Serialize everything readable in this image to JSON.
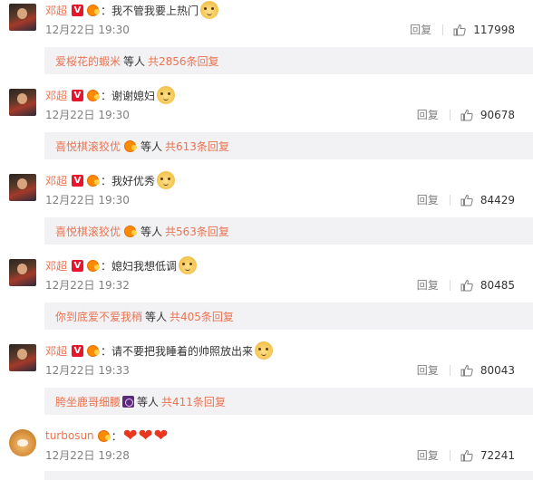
{
  "comments": [
    {
      "username": "邓超",
      "text": "：我不管我要上热门",
      "time": "12月22日 19:30",
      "reply_label": "回复",
      "likes": "117998",
      "reply_preview": {
        "who": "爱桜花的蝦米",
        "mid": "等人",
        "total": "共2856条回复"
      }
    },
    {
      "username": "邓超",
      "text": "：谢谢媳妇",
      "time": "12月22日 19:30",
      "reply_label": "回复",
      "likes": "90678",
      "reply_preview": {
        "who": "喜悦棋滚狡优",
        "mid": "等人",
        "total": "共613条回复"
      }
    },
    {
      "username": "邓超",
      "text": "：我好优秀",
      "time": "12月22日 19:30",
      "reply_label": "回复",
      "likes": "84429",
      "reply_preview": {
        "who": "喜悦棋滚狡优",
        "mid": "等人",
        "total": "共563条回复"
      }
    },
    {
      "username": "邓超",
      "text": "：媳妇我想低调",
      "time": "12月22日 19:32",
      "reply_label": "回复",
      "likes": "80485",
      "reply_preview": {
        "who": "你到底爱不爱我稍",
        "mid": "等人",
        "total": "共405条回复"
      }
    },
    {
      "username": "邓超",
      "text": "：请不要把我睡着的帅照放出来",
      "time": "12月22日 19:33",
      "reply_label": "回复",
      "likes": "80043",
      "reply_preview": {
        "who": "胯坐鹿哥细腰",
        "mid": "等人",
        "total": "共411条回复"
      }
    },
    {
      "username": "turbosun",
      "text": "：",
      "time": "12月22日 19:28",
      "reply_label": "回复",
      "likes": "72241"
    }
  ],
  "colors": {
    "accent": "#eb7350",
    "verified": "#e6162d",
    "heart": "#e8361f"
  },
  "icons": {
    "like": "thumbs-up-icon",
    "verified": "verified-v-icon",
    "fan": "fan-badge-icon",
    "emoji": "doge-emoji-icon",
    "heart": "heart-emoji-icon"
  }
}
